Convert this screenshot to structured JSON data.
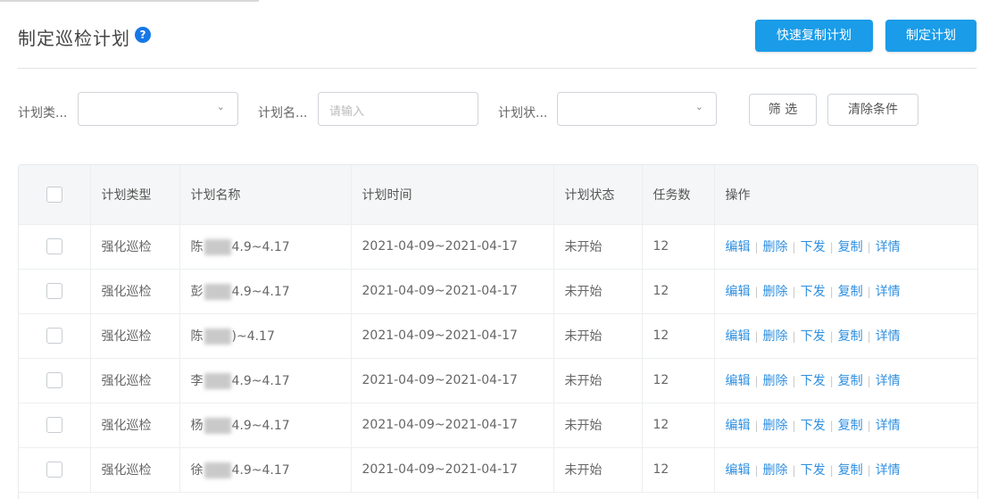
{
  "page": {
    "title": "制定巡检计划",
    "help_icon": "?"
  },
  "toolbar": {
    "quick_make_label": "快速复制计划",
    "make_label": "制定计划"
  },
  "filters": {
    "plan_type_label": "计划类...",
    "plan_name_label": "计划名...",
    "plan_name_placeholder": "请输入",
    "plan_status_label": "计划状...",
    "chevron": "⌄",
    "filter_button": "筛 选",
    "clear_button": "清除条件"
  },
  "table": {
    "columns": [
      "计划类型",
      "计划名称",
      "计划时间",
      "计划状态",
      "任务数",
      "操作"
    ],
    "actions": [
      "编辑",
      "删除",
      "下发",
      "复制",
      "详情"
    ],
    "rows": [
      {
        "type": "强化巡检",
        "name_prefix": "陈",
        "name_suffix": "4.9~4.17",
        "time": "2021-04-09~2021-04-17",
        "status": "未开始",
        "tasks": "12"
      },
      {
        "type": "强化巡检",
        "name_prefix": "彭",
        "name_suffix": "4.9~4.17",
        "time": "2021-04-09~2021-04-17",
        "status": "未开始",
        "tasks": "12"
      },
      {
        "type": "强化巡检",
        "name_prefix": "陈",
        "name_suffix": ")~4.17",
        "time": "2021-04-09~2021-04-17",
        "status": "未开始",
        "tasks": "12"
      },
      {
        "type": "强化巡检",
        "name_prefix": "李",
        "name_suffix": "4.9~4.17",
        "time": "2021-04-09~2021-04-17",
        "status": "未开始",
        "tasks": "12"
      },
      {
        "type": "强化巡检",
        "name_prefix": "杨",
        "name_suffix": "4.9~4.17",
        "time": "2021-04-09~2021-04-17",
        "status": "未开始",
        "tasks": "12"
      },
      {
        "type": "强化巡检",
        "name_prefix": "徐",
        "name_suffix": "4.9~4.17",
        "time": "2021-04-09~2021-04-17",
        "status": "未开始",
        "tasks": "12"
      }
    ]
  },
  "colors": {
    "primary": "#1a9ce8",
    "link": "#2f8fe0",
    "help": "#1677e6"
  }
}
